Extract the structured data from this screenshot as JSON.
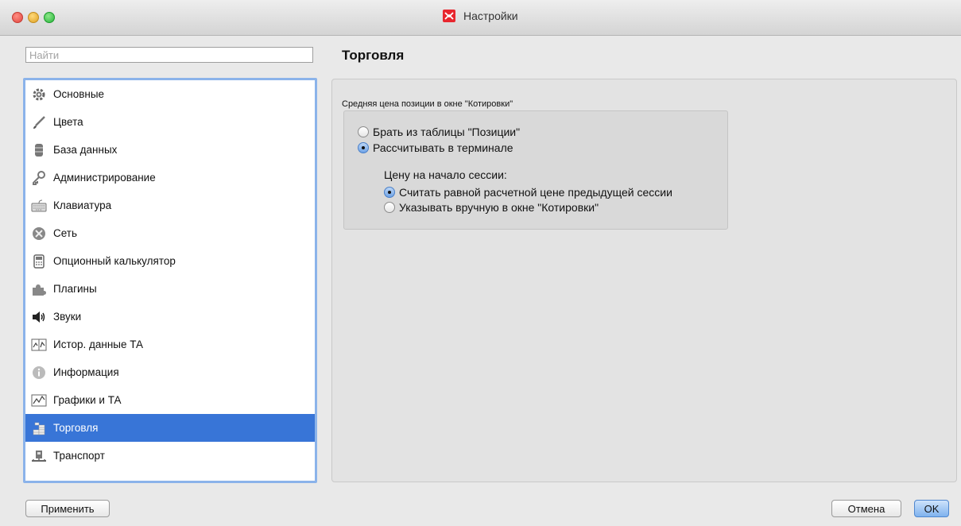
{
  "window": {
    "title": "Настройки"
  },
  "search": {
    "placeholder": "Найти",
    "value": ""
  },
  "sidebar": {
    "items": [
      {
        "label": "Основные",
        "icon": "gear-icon"
      },
      {
        "label": "Цвета",
        "icon": "brush-icon"
      },
      {
        "label": "База данных",
        "icon": "database-icon"
      },
      {
        "label": "Администрирование",
        "icon": "key-icon"
      },
      {
        "label": "Клавиатура",
        "icon": "keyboard-icon"
      },
      {
        "label": "Сеть",
        "icon": "network-icon"
      },
      {
        "label": "Опционный калькулятор",
        "icon": "calculator-icon"
      },
      {
        "label": "Плагины",
        "icon": "puzzle-icon"
      },
      {
        "label": "Звуки",
        "icon": "speaker-icon"
      },
      {
        "label": "Истор. данные ТА",
        "icon": "history-chart-icon"
      },
      {
        "label": "Информация",
        "icon": "info-icon"
      },
      {
        "label": "Графики и ТА",
        "icon": "line-chart-icon"
      },
      {
        "label": "Торговля",
        "icon": "coins-icon",
        "selected": true
      },
      {
        "label": "Транспорт",
        "icon": "transport-icon"
      }
    ]
  },
  "section": {
    "title": "Торговля",
    "group_label": "Средняя цена позиции в окне \"Котировки\"",
    "options": [
      {
        "label": "Брать из таблицы \"Позиции\"",
        "checked": false
      },
      {
        "label": "Рассчитывать в терминале",
        "checked": true
      }
    ],
    "session_label": "Цену на начало сессии:",
    "session_options": [
      {
        "label": "Считать равной расчетной цене предыдущей сессии",
        "checked": true
      },
      {
        "label": "Указывать вручную в окне \"Котировки\"",
        "checked": false
      }
    ]
  },
  "buttons": {
    "apply": "Применить",
    "cancel": "Отмена",
    "ok": "OK"
  },
  "colors": {
    "selection": "#3875d7",
    "focus_ring": "#8bb3ea",
    "logo": "#e8262e"
  }
}
